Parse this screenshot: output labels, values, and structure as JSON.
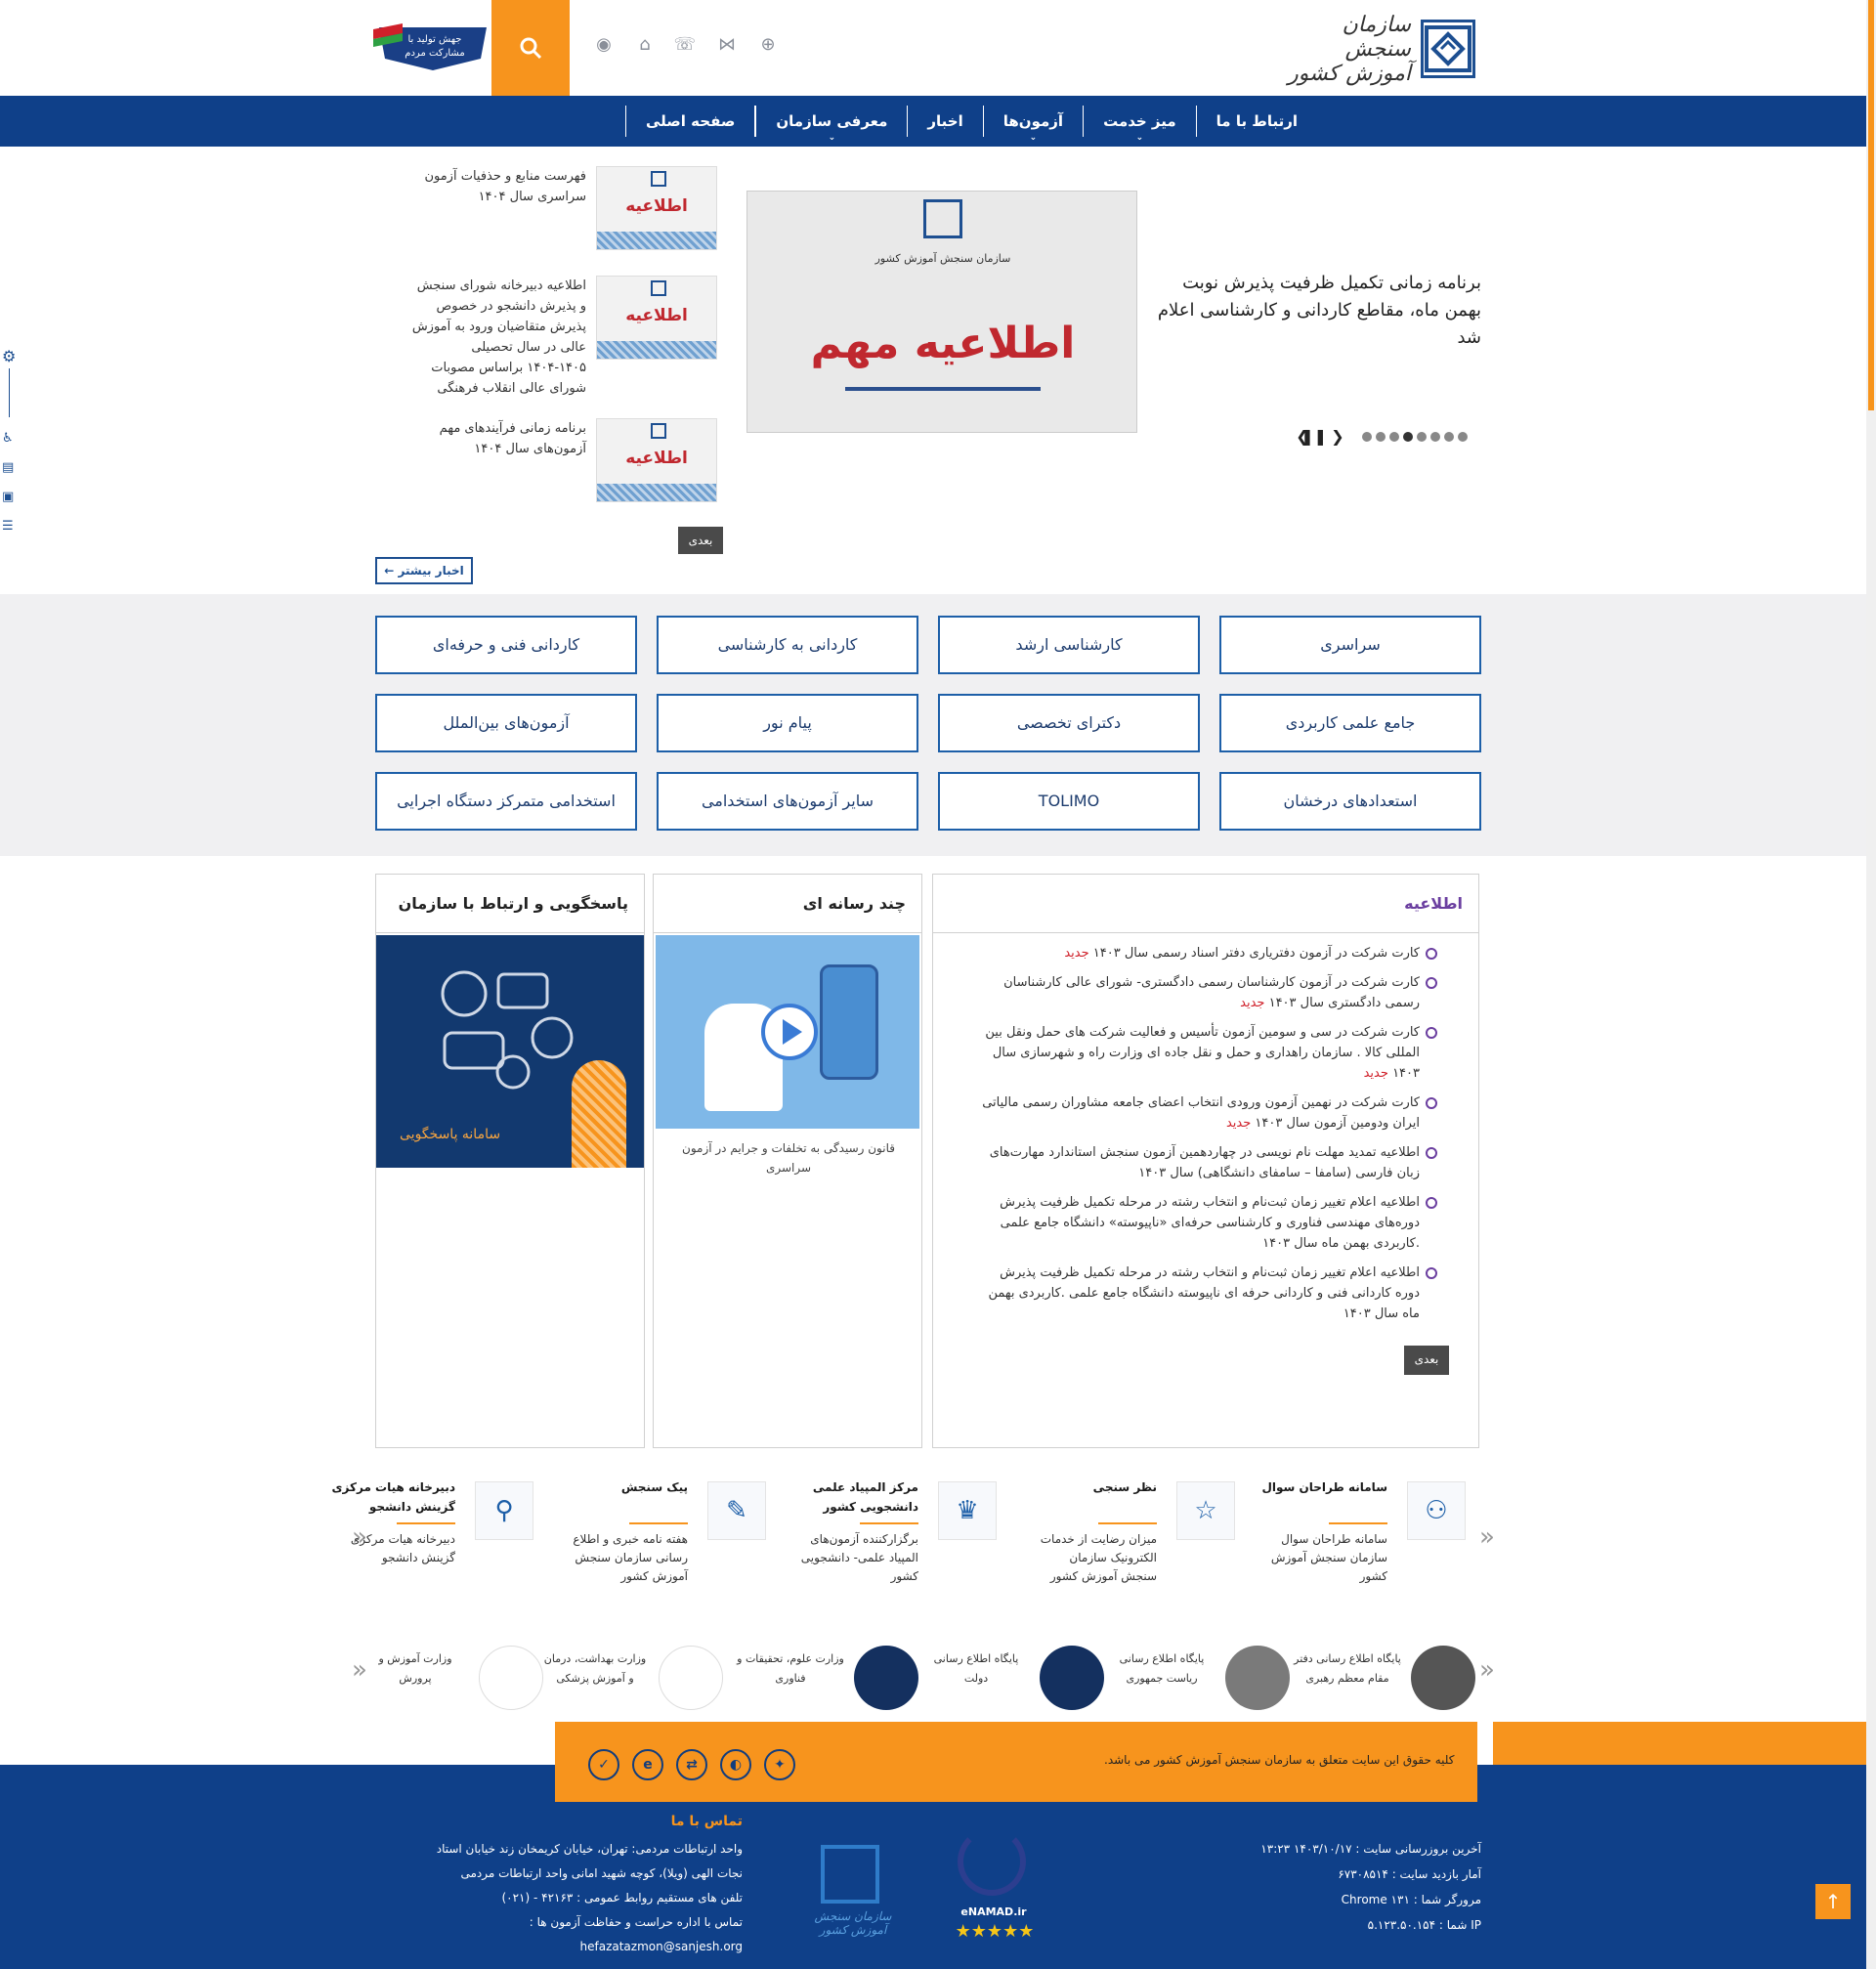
{
  "header": {
    "logo_text": "سازمان سنجش آموزش کشور",
    "campaign_text": "جهش تولید با مشارکت مردم",
    "icons": [
      "rss-icon",
      "home-icon",
      "phone-icon",
      "share-icon",
      "globe-icon"
    ]
  },
  "nav": {
    "items": [
      "صفحه اصلی",
      "معرفی سازمان",
      "اخبار",
      "آزمون‌ها",
      "میز خدمت",
      "ارتباط با ما"
    ]
  },
  "slider": {
    "title": "برنامه زمانی تکمیل ظرفیت پذیرش نوبت بهمن ماه، مقاطع کاردانی و کارشناسی اعلام شد",
    "image_caption": "اطلاعیه مهم",
    "image_logo_text": "سازمان سنجش آموزش کشور",
    "dots": 8,
    "active_dot": 3
  },
  "side_news": [
    {
      "title": "فهرست منابع و حذفیات آزمون سراسری سال ۱۴۰۴",
      "thumb_label": "اطلاعیه"
    },
    {
      "title": "اطلاعیه دبیرخانه شورای سنجش و پذیرش دانشجو در خصوص پذیرش متقاضیان ورود به آموزش عالی در سال تحصیلی ۱۴۰۵-۱۴۰۴ براساس مصوبات شورای عالی انقلاب فرهنگی",
      "thumb_label": "اطلاعیه"
    },
    {
      "title": "برنامه زمانی فرآیندهای مهم آزمون‌های سال ۱۴۰۴",
      "thumb_label": "اطلاعیه"
    }
  ],
  "next_label": "بعدی",
  "more_news_label": "اخبار بیشتر ←",
  "exams": [
    [
      "سراسری",
      "کارشناسی ارشد",
      "کاردانی به کارشناسی",
      "کاردانی فنی و حرفه‌ای"
    ],
    [
      "جامع علمی کاربردی",
      "دکترای تخصصی",
      "پیام نور",
      "آزمون‌های بین‌الملل"
    ],
    [
      "استعدادهای درخشان",
      "TOLIMO",
      "سایر آزمون‌های استخدامی",
      "استخدامی متمرکز دستگاه اجرایی"
    ]
  ],
  "notice_box": {
    "title": "اطلاعیه",
    "new_label": "جدید",
    "items": [
      {
        "text": "کارت شرکت در آزمون دفتریاری دفتر اسناد رسمی سال ۱۴۰۳",
        "new": true
      },
      {
        "text": "کارت شرکت در آزمون کارشناسان رسمی دادگستری- شورای عالی کارشناسان رسمی دادگستری سال ۱۴۰۳",
        "new": true
      },
      {
        "text": "کارت شرکت در سی و سومین آزمون تأسیس و فعالیت شرکت های حمل ونقل بین المللی کالا . سازمان راهداری و حمل و نقل جاده ای وزارت راه و شهرسازی سال ۱۴۰۳",
        "new": true
      },
      {
        "text": "کارت شرکت در نهمین آزمون ورودی انتخاب اعضای جامعه مشاوران رسمی مالیاتی ایران ودومین آزمون سال ۱۴۰۳",
        "new": true
      },
      {
        "text": "اطلاعیه تمدید مهلت نام نویسی در چهاردهمین آزمون سنجش استاندارد مهارت‌های زبان فارسی (سامفا – سامفای دانشگاهی) سال ۱۴۰۳",
        "new": false
      },
      {
        "text": "اطلاعیه اعلام تغییر زمان ثبت‌نام و انتخاب رشته در مرحله تکمیل ظرفیت پذیرش دوره‌های مهندسی فناوری و کارشناسی حرفه‌ای «ناپیوسته» دانشگاه جامع علمی .کاربردی بهمن ماه سال ۱۴۰۳",
        "new": false
      },
      {
        "text": "اطلاعیه اعلام تغییر زمان ثبت‌نام و انتخاب رشته در مرحله تکمیل ظرفیت پذیرش دوره کاردانی فنی و کاردانی حرفه ای ناپیوسته دانشگاه جامع علمی .کاربردی بهمن ماه سال ۱۴۰۳",
        "new": false
      }
    ]
  },
  "media_box": {
    "title": "چند رسانه ای",
    "caption": "قانون رسیدگی به تخلفات و جرایم در آزمون سراسری"
  },
  "contact_box": {
    "title": "پاسخگویی و ارتباط با سازمان",
    "banner_label": "سامانه پاسخگویی"
  },
  "services": [
    {
      "title": "سامانه طراحان سوال",
      "desc": "سامانه طراحان سوال سازمان سنجش آموزش کشور",
      "icon": "people-icon"
    },
    {
      "title": "نظر سنجی",
      "desc": "میزان رضایت از خدمات الکترونیک سازمان سنجش آموزش کشور",
      "icon": "survey-icon"
    },
    {
      "title": "مرکز المپیاد علمی دانشجویی کشور",
      "desc": "برگزارکننده آزمون‌های المپیاد علمی- دانشجویی کشور",
      "icon": "olympiad-icon"
    },
    {
      "title": "پیک سنجش",
      "desc": "هفته نامه خبری و اطلاع رسانی سازمان سنجش  آموزش کشور",
      "icon": "newsletter-icon"
    },
    {
      "title": "دبیرخانه هیات مرکزی گزینش دانشجو",
      "desc": "دبیرخانه هیات مرکزی گزینش دانشجو",
      "icon": "selection-icon"
    }
  ],
  "links": [
    {
      "title": "پایگاه اطلاع رسانی دفتر مقام معظم رهبری"
    },
    {
      "title": "پایگاه اطلاع رسانی ریاست جمهوری"
    },
    {
      "title": "پایگاه اطلاع رسانی دولت"
    },
    {
      "title": "وزارت علوم، تحقیقات و فناوری"
    },
    {
      "title": "وزارت بهداشت، درمان و آموزش پزشکی"
    },
    {
      "title": "وزارت آموزش و پرورش"
    }
  ],
  "footer": {
    "copyright": "کلیه حقوق این سایت متعلق به سازمان سنجش آموزش کشور می باشد.",
    "social": [
      "aparat-icon",
      "eitaa-icon",
      "rubika-icon",
      "bale-icon",
      "soroush-icon"
    ],
    "stats": [
      "آخرین بروزرسانی سایت : ۱۴۰۳/۱۰/۱۷ ۱۳:۲۳",
      "آمار بازدید سایت : ۶۷۳۰۸۵۱۴",
      "مرورگر شما : Chrome ۱۳۱",
      "IP شما : ۵.۱۲۳.۵۰.۱۵۴"
    ],
    "enamad_label": "eNAMAD.ir",
    "logo_text": "سازمان سنجش آموزش کشور",
    "contact_title": "تماس با ما",
    "contact_lines": [
      "واحد ارتباطات مردمی: تهران، خیابان کریمخان زند خیابان استاد",
      "نجات الهی (ویلا)، کوچه شهید امانی واحد ارتباطات مردمی",
      "تلفن های مستقیم روابط عمومی : ۴۲۱۶۳ - (۰۲۱)",
      "تماس با اداره حراست و حفاظت آزمون ها :",
      "hefazatazmon@sanjesh.org"
    ]
  }
}
